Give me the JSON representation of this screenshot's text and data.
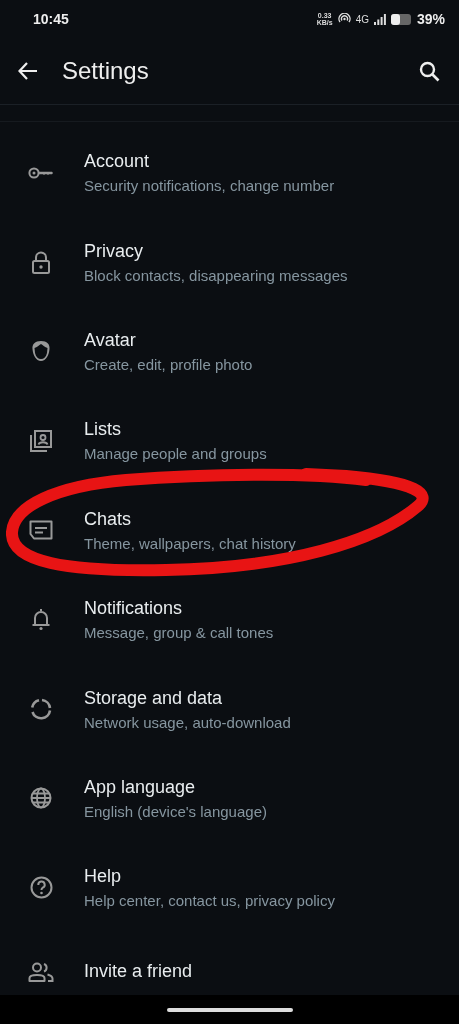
{
  "status_bar": {
    "time": "10:45",
    "speed": "0.33",
    "speed_unit": "KB/s",
    "network": "4G",
    "battery": "39%"
  },
  "app_bar": {
    "title": "Settings"
  },
  "items": [
    {
      "title": "Account",
      "subtitle": "Security notifications, change number",
      "circled": false
    },
    {
      "title": "Privacy",
      "subtitle": "Block contacts, disappearing messages",
      "circled": false
    },
    {
      "title": "Avatar",
      "subtitle": "Create, edit, profile photo",
      "circled": false
    },
    {
      "title": "Lists",
      "subtitle": "Manage people and groups",
      "circled": false
    },
    {
      "title": "Chats",
      "subtitle": "Theme, wallpapers, chat history",
      "circled": true
    },
    {
      "title": "Notifications",
      "subtitle": "Message, group & call tones",
      "circled": false
    },
    {
      "title": "Storage and data",
      "subtitle": "Network usage, auto-download",
      "circled": false
    },
    {
      "title": "App language",
      "subtitle": "English (device's language)",
      "circled": false
    },
    {
      "title": "Help",
      "subtitle": "Help center, contact us, privacy policy",
      "circled": false
    },
    {
      "title": "Invite a friend",
      "circled": false
    }
  ]
}
